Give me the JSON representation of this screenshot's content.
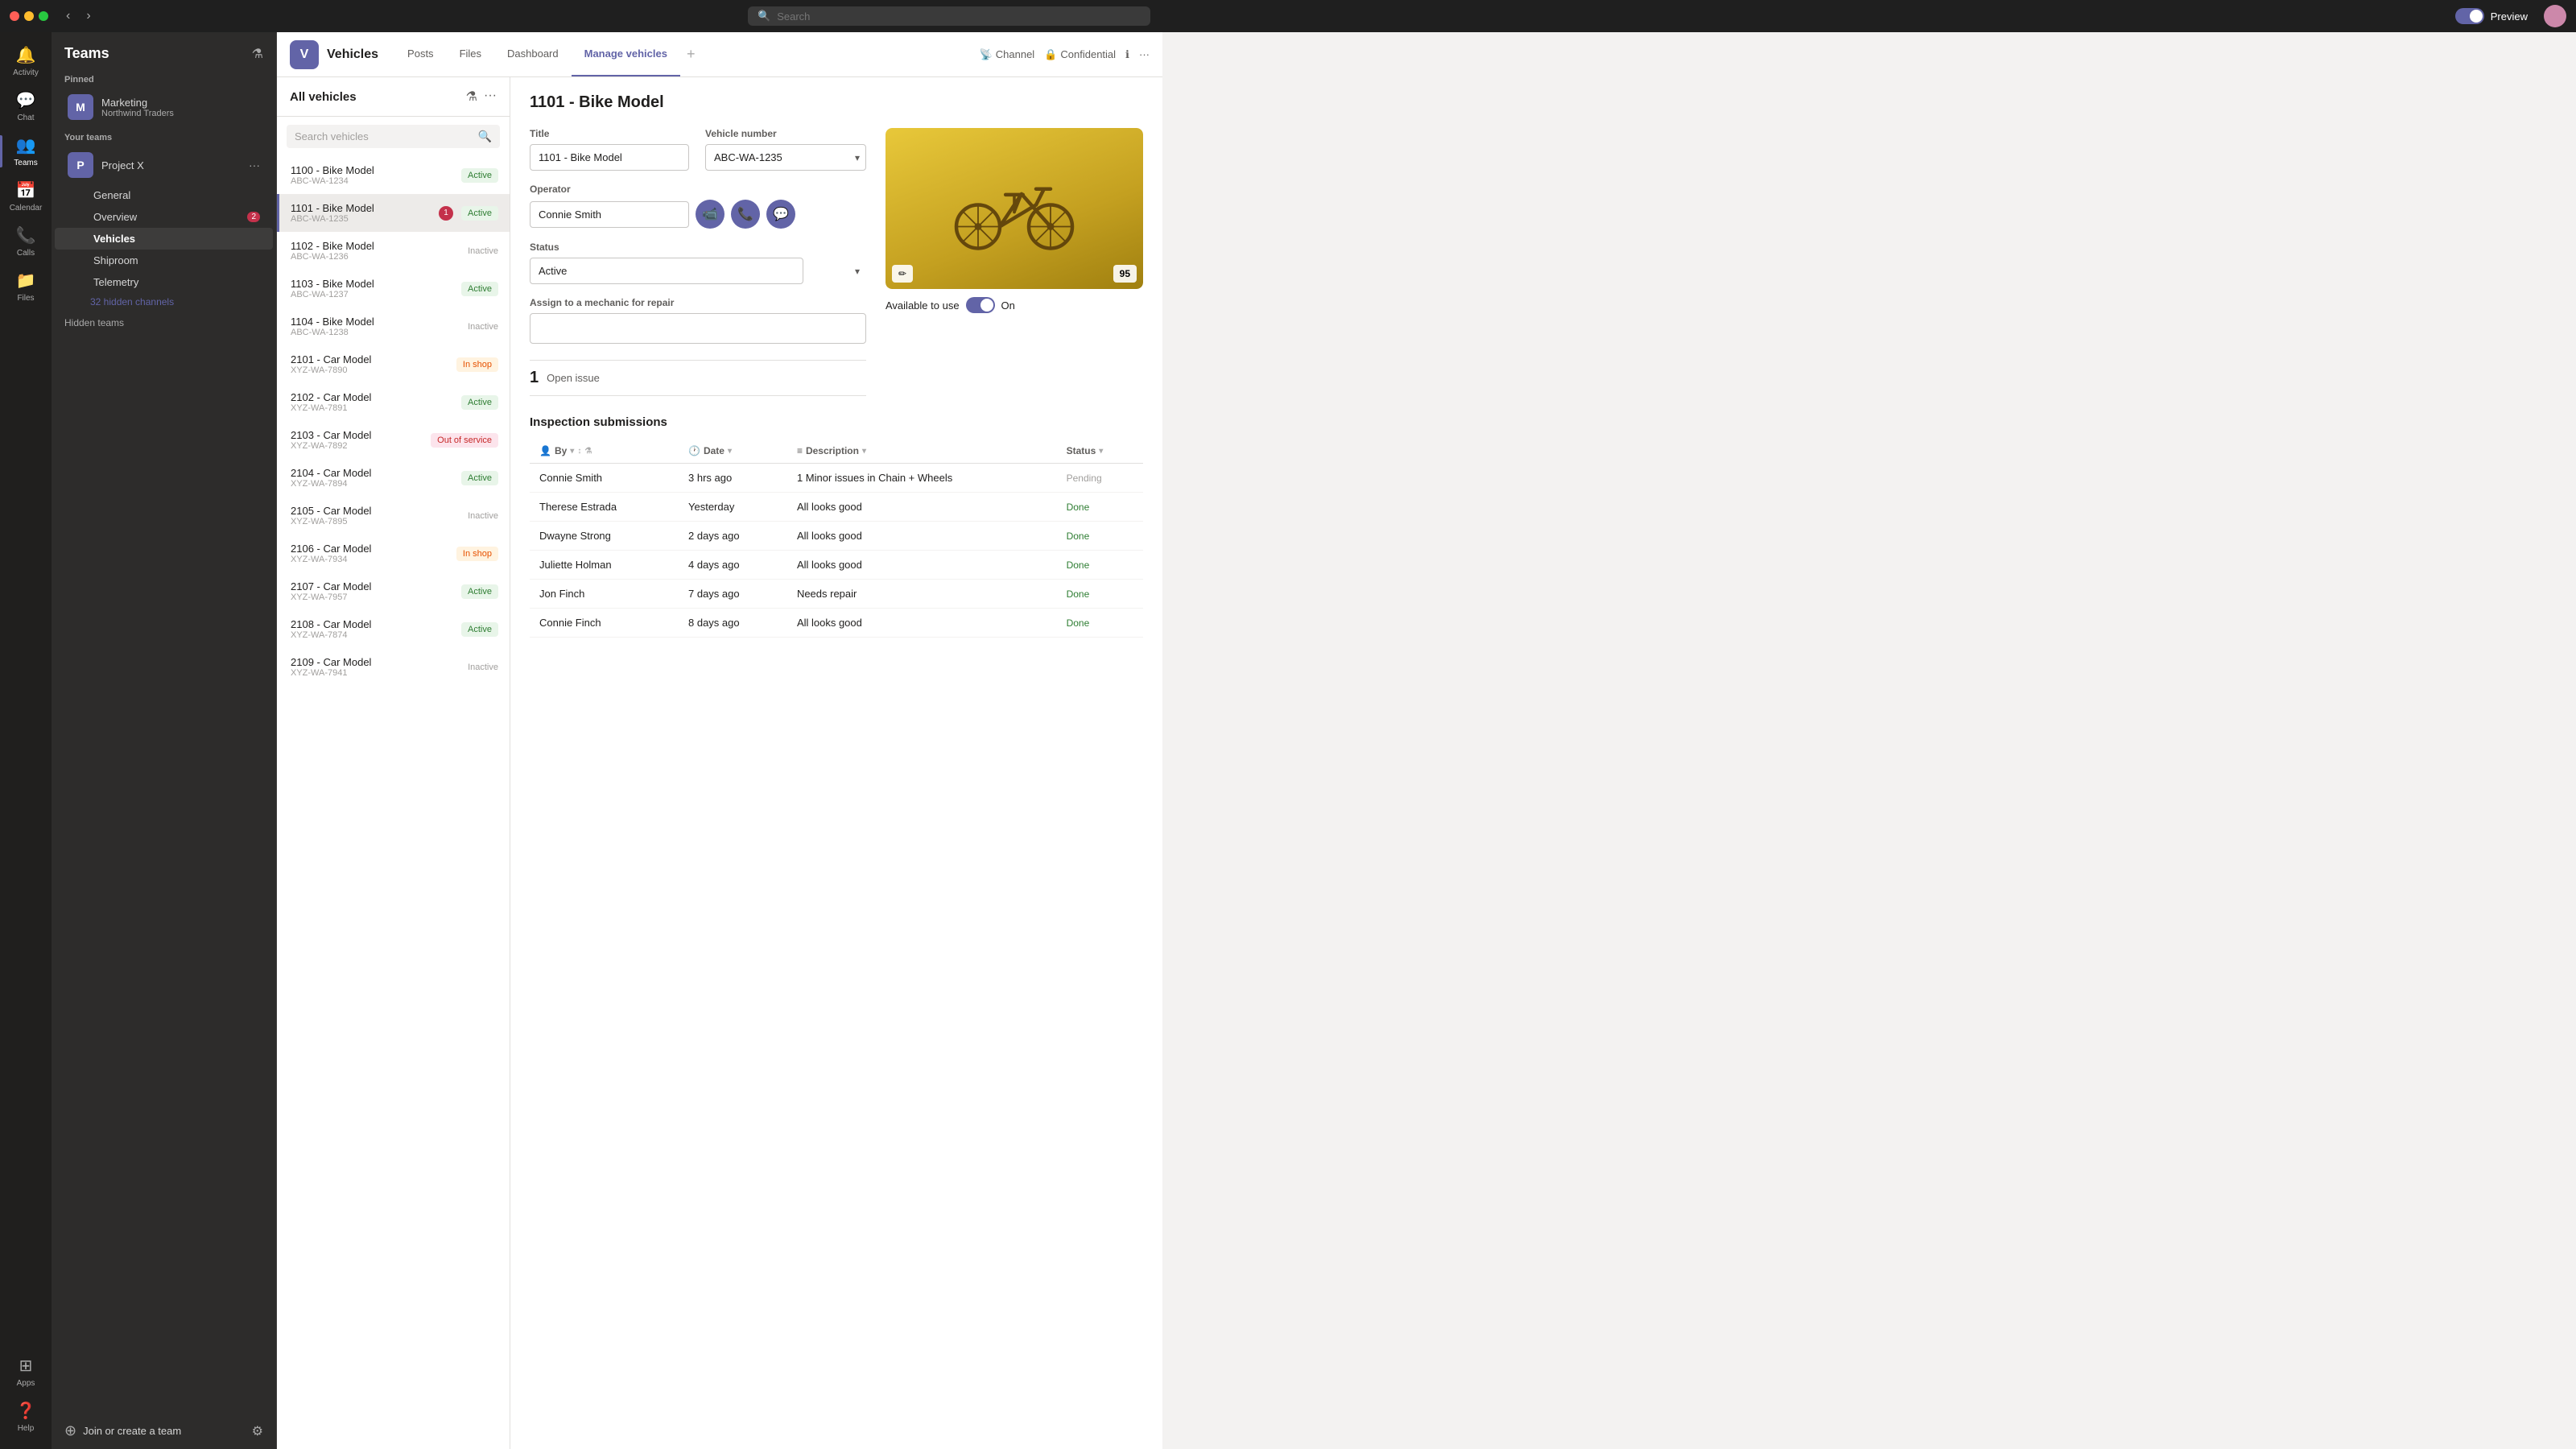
{
  "titlebar": {
    "search_placeholder": "Search",
    "preview_label": "Preview",
    "dots": [
      "red",
      "yellow",
      "green"
    ]
  },
  "icon_sidebar": {
    "items": [
      {
        "id": "activity",
        "label": "Activity",
        "icon": "🔔",
        "active": false
      },
      {
        "id": "chat",
        "label": "Chat",
        "icon": "💬",
        "active": false
      },
      {
        "id": "teams",
        "label": "Teams",
        "icon": "👥",
        "active": true
      },
      {
        "id": "calendar",
        "label": "Calendar",
        "icon": "📅",
        "active": false
      },
      {
        "id": "calls",
        "label": "Calls",
        "icon": "📞",
        "active": false
      },
      {
        "id": "files",
        "label": "Files",
        "icon": "📁",
        "active": false
      }
    ],
    "bottom_items": [
      {
        "id": "apps",
        "label": "Apps",
        "icon": "⊞"
      },
      {
        "id": "help",
        "label": "Help",
        "icon": "❓"
      }
    ]
  },
  "teams_sidebar": {
    "title": "Teams",
    "filter_icon": "▼",
    "pinned_label": "Pinned",
    "pinned_team": {
      "name": "Marketing",
      "org": "Northwind Traders",
      "logo": "M"
    },
    "your_teams_label": "Your teams",
    "teams": [
      {
        "name": "Project X",
        "logo": "P",
        "more": true,
        "channels": [
          {
            "name": "General",
            "active": false,
            "unread": 0
          },
          {
            "name": "Overview",
            "active": false,
            "unread": 2
          },
          {
            "name": "Vehicles",
            "active": true,
            "unread": 0
          },
          {
            "name": "Shiproom",
            "active": false,
            "unread": 0
          },
          {
            "name": "Telemetry",
            "active": false,
            "unread": 0
          }
        ],
        "hidden_channels": "32 hidden channels"
      }
    ],
    "hidden_teams_label": "Hidden teams",
    "join_create_label": "Join or create a team",
    "more_label": "..."
  },
  "channel_header": {
    "logo": "V",
    "channel_name": "Vehicles",
    "tabs": [
      {
        "label": "Posts",
        "active": false
      },
      {
        "label": "Files",
        "active": false
      },
      {
        "label": "Dashboard",
        "active": false
      },
      {
        "label": "Manage vehicles",
        "active": true
      }
    ],
    "add_tab": "+",
    "actions": [
      "Channel",
      "Confidential",
      "ℹ",
      "···"
    ]
  },
  "vehicle_list": {
    "title": "All vehicles",
    "search_placeholder": "Search vehicles",
    "vehicles": [
      {
        "name": "1100 - Bike Model",
        "id": "ABC-WA-1234",
        "status": "Active",
        "status_type": "active",
        "selected": false,
        "badge": 0
      },
      {
        "name": "1101 - Bike Model",
        "id": "ABC-WA-1235",
        "status": "Active",
        "status_type": "active",
        "selected": true,
        "badge": 1
      },
      {
        "name": "1102 - Bike Model",
        "id": "ABC-WA-1236",
        "status": "Inactive",
        "status_type": "inactive",
        "selected": false,
        "badge": 0
      },
      {
        "name": "1103 - Bike Model",
        "id": "ABC-WA-1237",
        "status": "Active",
        "status_type": "active",
        "selected": false,
        "badge": 0
      },
      {
        "name": "1104 - Bike Model",
        "id": "ABC-WA-1238",
        "status": "Inactive",
        "status_type": "inactive",
        "selected": false,
        "badge": 0
      },
      {
        "name": "2101 - Car Model",
        "id": "XYZ-WA-7890",
        "status": "In shop",
        "status_type": "inshop",
        "selected": false,
        "badge": 0
      },
      {
        "name": "2102 - Car Model",
        "id": "XYZ-WA-7891",
        "status": "Active",
        "status_type": "active",
        "selected": false,
        "badge": 0
      },
      {
        "name": "2103 - Car Model",
        "id": "XYZ-WA-7892",
        "status": "Out of service",
        "status_type": "outofservice",
        "selected": false,
        "badge": 0
      },
      {
        "name": "2104 - Car Model",
        "id": "XYZ-WA-7894",
        "status": "Active",
        "status_type": "active",
        "selected": false,
        "badge": 0
      },
      {
        "name": "2105 - Car Model",
        "id": "XYZ-WA-7895",
        "status": "Inactive",
        "status_type": "inactive",
        "selected": false,
        "badge": 0
      },
      {
        "name": "2106 - Car Model",
        "id": "XYZ-WA-7934",
        "status": "In shop",
        "status_type": "inshop",
        "selected": false,
        "badge": 0
      },
      {
        "name": "2107 - Car Model",
        "id": "XYZ-WA-7957",
        "status": "Active",
        "status_type": "active",
        "selected": false,
        "badge": 0
      },
      {
        "name": "2108 - Car Model",
        "id": "XYZ-WA-7874",
        "status": "Active",
        "status_type": "active",
        "selected": false,
        "badge": 0
      },
      {
        "name": "2109 - Car Model",
        "id": "XYZ-WA-7941",
        "status": "Inactive",
        "status_type": "inactive",
        "selected": false,
        "badge": 0
      }
    ]
  },
  "vehicle_detail": {
    "title": "1101 - Bike Model",
    "title_field_label": "Title",
    "title_value": "1101 - Bike Model",
    "vehicle_number_label": "Vehicle number",
    "vehicle_number_value": "ABC-WA-1235",
    "operator_label": "Operator",
    "operator_value": "Connie Smith",
    "operator_actions": [
      "video",
      "phone",
      "chat"
    ],
    "status_label": "Status",
    "status_value": "Active",
    "assign_mechanic_label": "Assign to a mechanic for repair",
    "assign_mechanic_value": "",
    "open_issue_count": "1",
    "open_issue_label": "Open issue",
    "available_label": "Available to use",
    "toggle_state": "On",
    "image_score": "95"
  },
  "inspection": {
    "title": "Inspection submissions",
    "columns": [
      "By",
      "Date",
      "Description",
      "Status"
    ],
    "rows": [
      {
        "by": "Connie Smith",
        "date": "3 hrs ago",
        "description": "1 Minor issues in Chain + Wheels",
        "status": "Pending"
      },
      {
        "by": "Therese Estrada",
        "date": "Yesterday",
        "description": "All looks good",
        "status": "Done"
      },
      {
        "by": "Dwayne Strong",
        "date": "2 days ago",
        "description": "All looks good",
        "status": "Done"
      },
      {
        "by": "Juliette Holman",
        "date": "4 days ago",
        "description": "All looks good",
        "status": "Done"
      },
      {
        "by": "Jon Finch",
        "date": "7 days ago",
        "description": "Needs repair",
        "status": "Done"
      },
      {
        "by": "Connie Finch",
        "date": "8 days ago",
        "description": "All looks good",
        "status": "Done"
      }
    ]
  }
}
